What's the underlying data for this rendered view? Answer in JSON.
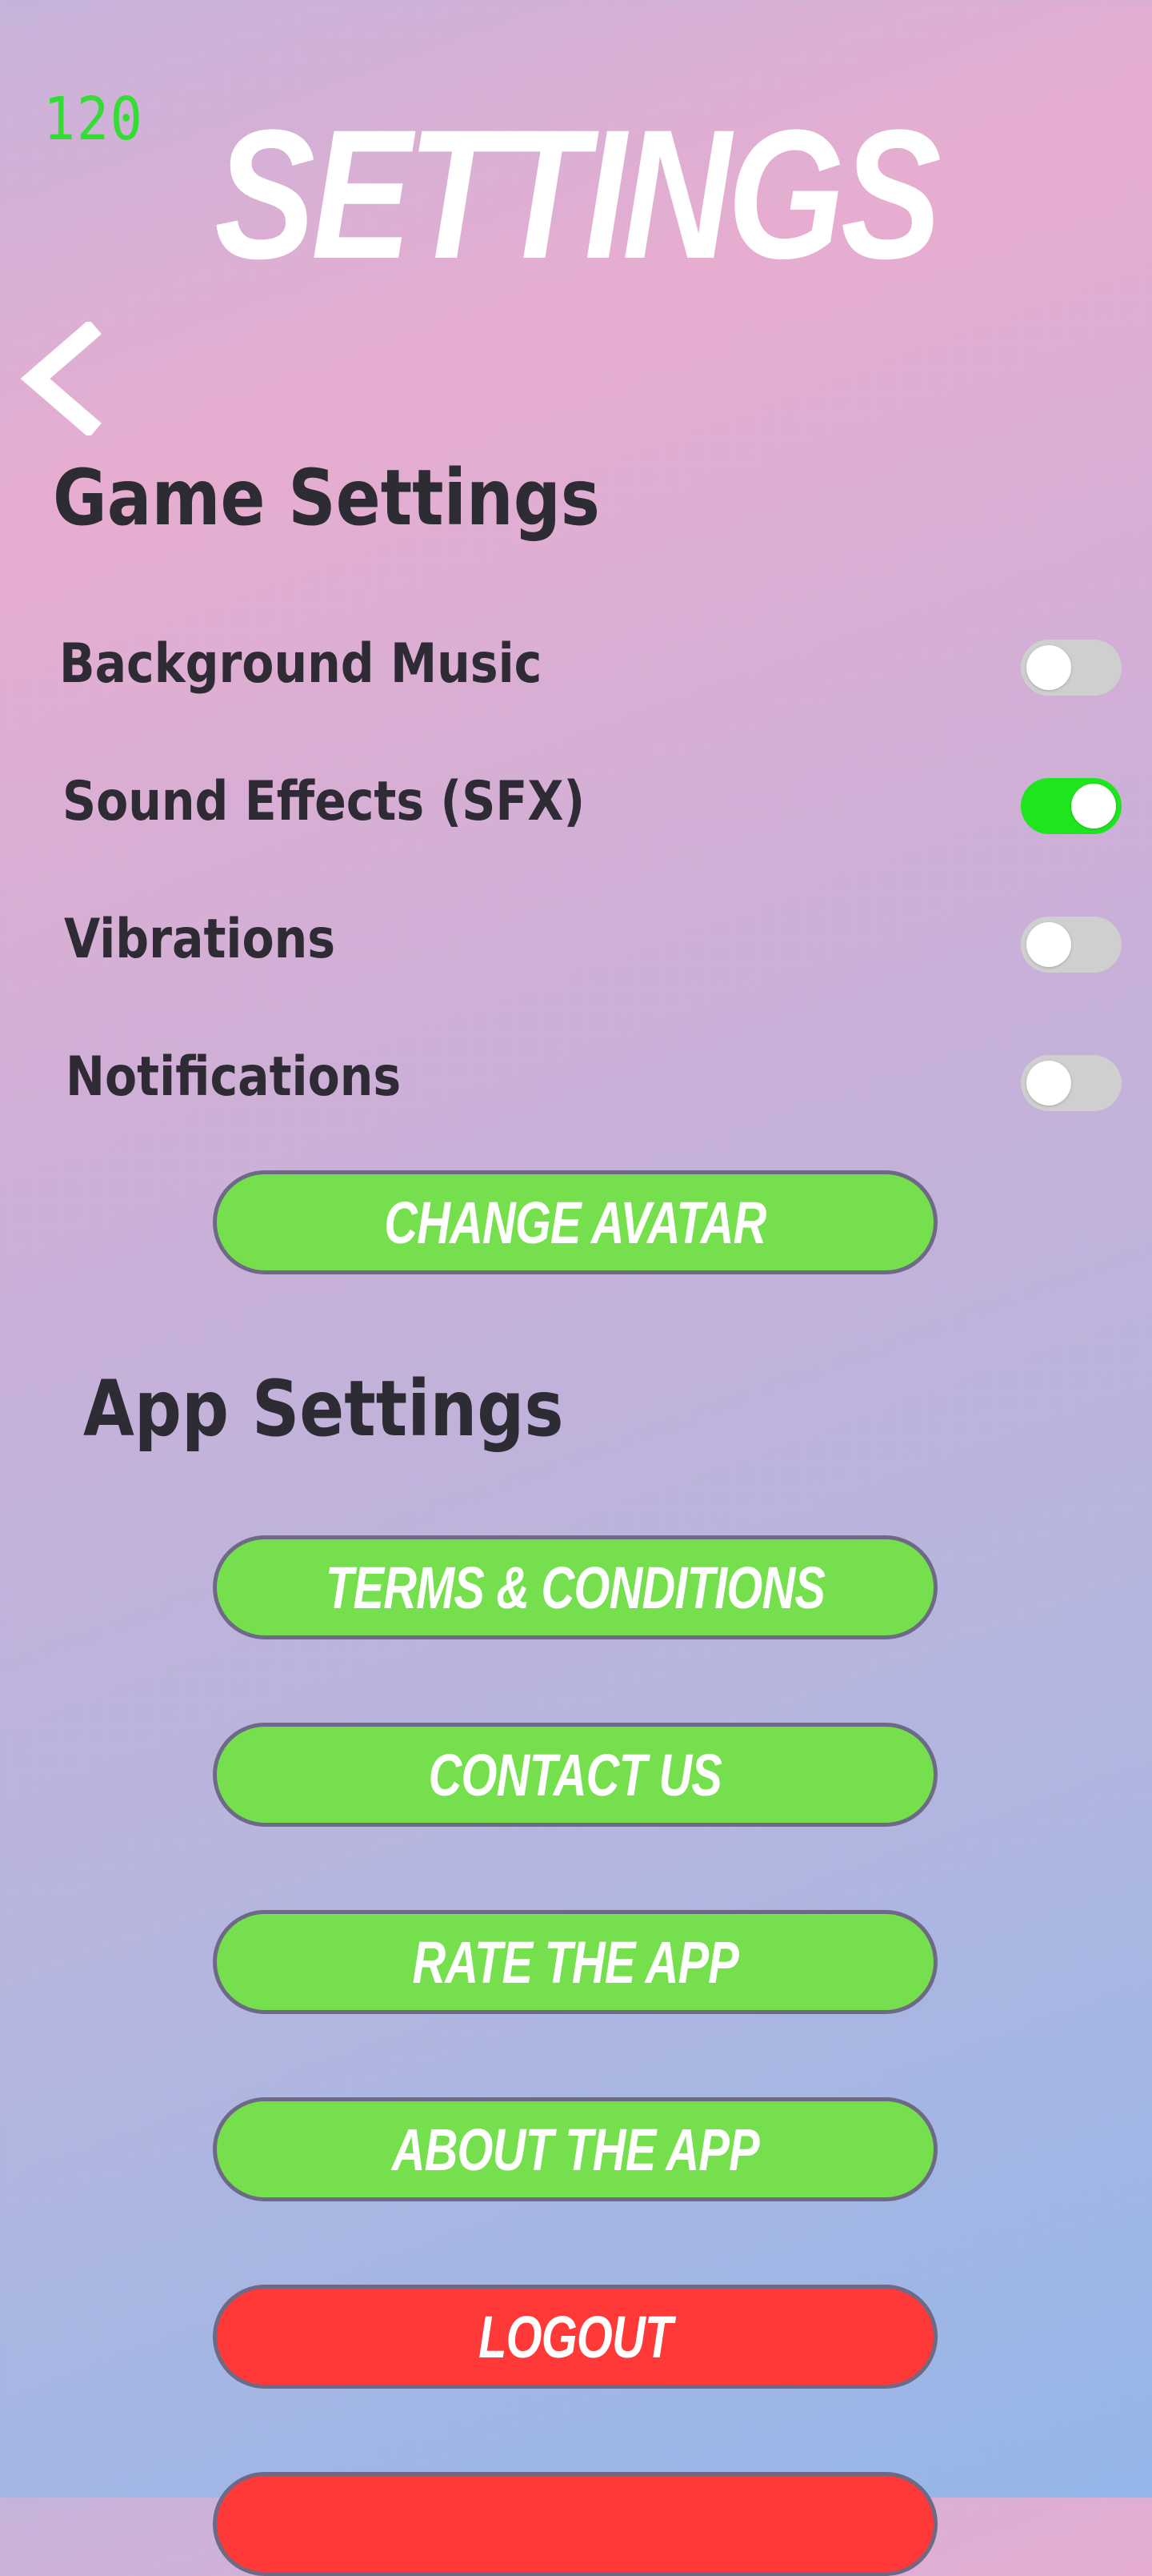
{
  "status": {
    "fps_counter": "120"
  },
  "header": {
    "title": "SETTINGS",
    "back_icon": "chevron-left-icon"
  },
  "game_settings": {
    "heading": "Game Settings",
    "items": [
      {
        "label": "Background Music",
        "enabled": false
      },
      {
        "label": "Sound Effects (SFX)",
        "enabled": true
      },
      {
        "label": "Vibrations",
        "enabled": false
      },
      {
        "label": "Notifications",
        "enabled": false
      }
    ],
    "change_avatar_label": "CHANGE AVATAR"
  },
  "app_settings": {
    "heading": "App Settings",
    "terms_label": "TERMS & CONDITIONS",
    "contact_label": "CONTACT US",
    "rate_label": "RATE THE APP",
    "about_label": "ABOUT THE APP",
    "logout_label": "LOGOUT"
  },
  "colors": {
    "toggle_on": "#1fe51f",
    "toggle_off": "#cfcfcf",
    "primary_button": "#76df4e",
    "danger_button": "#ff3838",
    "title_text": "#ffffff",
    "fps_text": "#33dd33"
  }
}
